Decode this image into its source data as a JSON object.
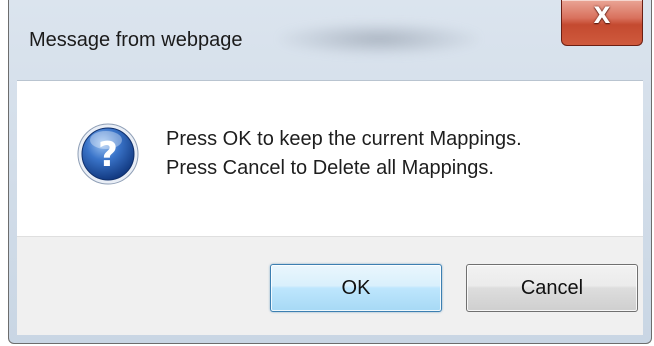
{
  "dialog": {
    "title": "Message from webpage",
    "close_glyph": "X",
    "icon": "question-icon",
    "message_line1": "Press OK to keep the current Mappings.",
    "message_line2": "Press Cancel to Delete all Mappings.",
    "ok_label": "OK",
    "cancel_label": "Cancel"
  },
  "colors": {
    "close_button": "#c44a30",
    "ok_border": "#3c7fb1",
    "icon_blue": "#1c4fa0"
  }
}
